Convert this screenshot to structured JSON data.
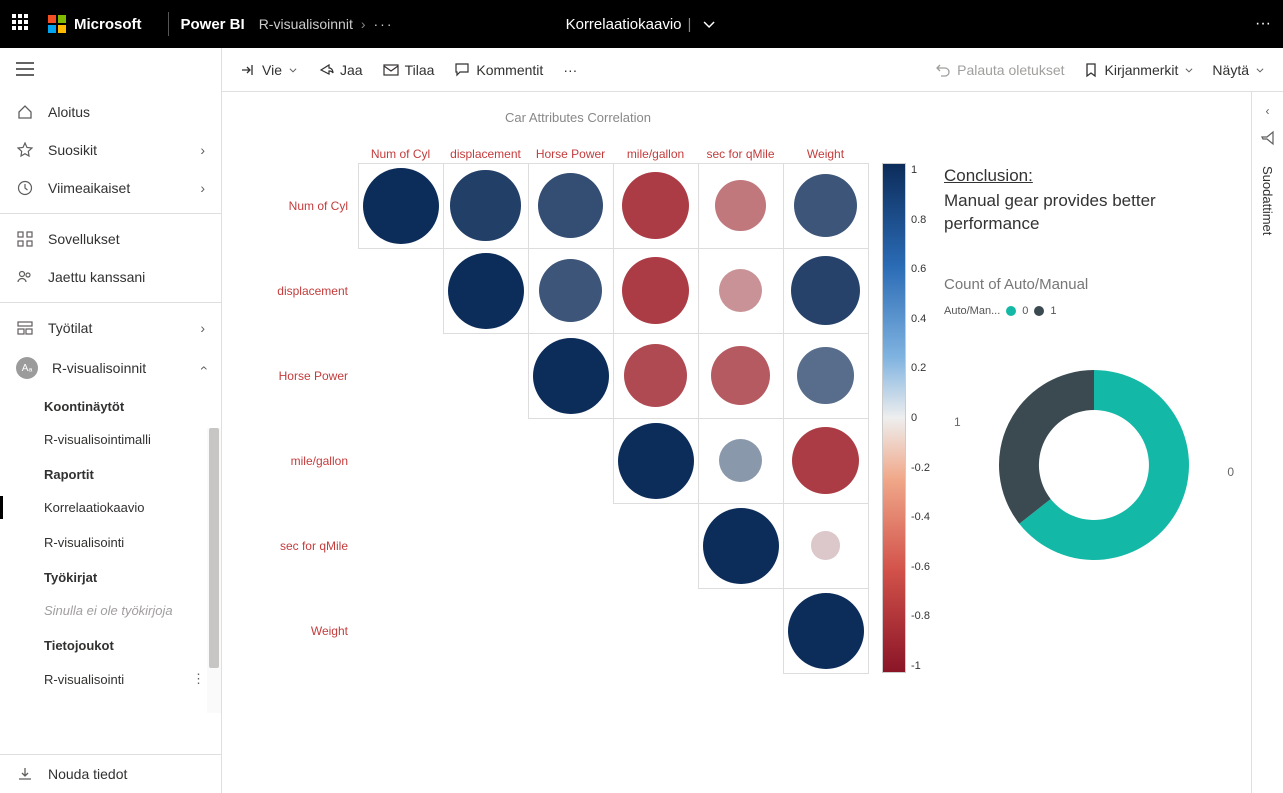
{
  "header": {
    "ms": "Microsoft",
    "product": "Power BI",
    "breadcrumb1": "R-visualisoinnit",
    "title": "Korrelaatiokaavio"
  },
  "sidebar": {
    "home": "Aloitus",
    "favorites": "Suosikit",
    "recent": "Viimeaikaiset",
    "apps": "Sovellukset",
    "shared": "Jaettu kanssani",
    "workspaces": "Työtilat",
    "currentWs": "R-visualisoinnit",
    "sections": {
      "dashboards": "Koontinäytöt",
      "dash_item": "R-visualisointimalli",
      "reports": "Raportit",
      "rpt_item1": "Korrelaatiokaavio",
      "rpt_item2": "R-visualisointi",
      "workbooks": "Työkirjat",
      "wb_empty": "Sinulla ei ole työkirjoja",
      "datasets": "Tietojoukot",
      "ds_item": "R-visualisointi"
    },
    "getData": "Nouda tiedot"
  },
  "toolbar": {
    "export": "Vie",
    "share": "Jaa",
    "subscribe": "Tilaa",
    "comments": "Kommentit",
    "reset": "Palauta oletukset",
    "bookmarks": "Kirjanmerkit",
    "view": "Näytä"
  },
  "filterPanel": "Suodattimet",
  "chart_data": [
    {
      "type": "heatmap",
      "title": "Car Attributes Correlation",
      "variables": [
        "Num of Cyl",
        "displacement",
        "Horse Power",
        "mile/gallon",
        "sec for qMile",
        "Weight"
      ],
      "colorbar_ticks": [
        "1",
        "0.8",
        "0.6",
        "0.4",
        "0.2",
        "0",
        "-0.2",
        "-0.4",
        "-0.6",
        "-0.8",
        "-1"
      ],
      "matrix": [
        [
          1.0,
          0.9,
          0.82,
          -0.85,
          -0.55,
          0.78
        ],
        [
          null,
          1.0,
          0.78,
          -0.85,
          -0.42,
          0.88
        ],
        [
          null,
          null,
          1.0,
          -0.78,
          -0.7,
          0.65
        ],
        [
          null,
          null,
          null,
          1.0,
          0.42,
          -0.85
        ],
        [
          null,
          null,
          null,
          null,
          1.0,
          -0.15
        ],
        [
          null,
          null,
          null,
          null,
          null,
          1.0
        ]
      ]
    },
    {
      "type": "pie",
      "title": "Count of Auto/Manual",
      "legend_label": "Auto/Man...",
      "series": [
        {
          "name": "0",
          "value": 19,
          "color": "#14b8a6"
        },
        {
          "name": "1",
          "value": 13,
          "color": "#3a4a50"
        }
      ],
      "callouts": {
        "right": "0",
        "left": "1"
      }
    }
  ],
  "conclusion": {
    "heading": "Conclusion:",
    "body": "Manual gear provides better performance"
  }
}
